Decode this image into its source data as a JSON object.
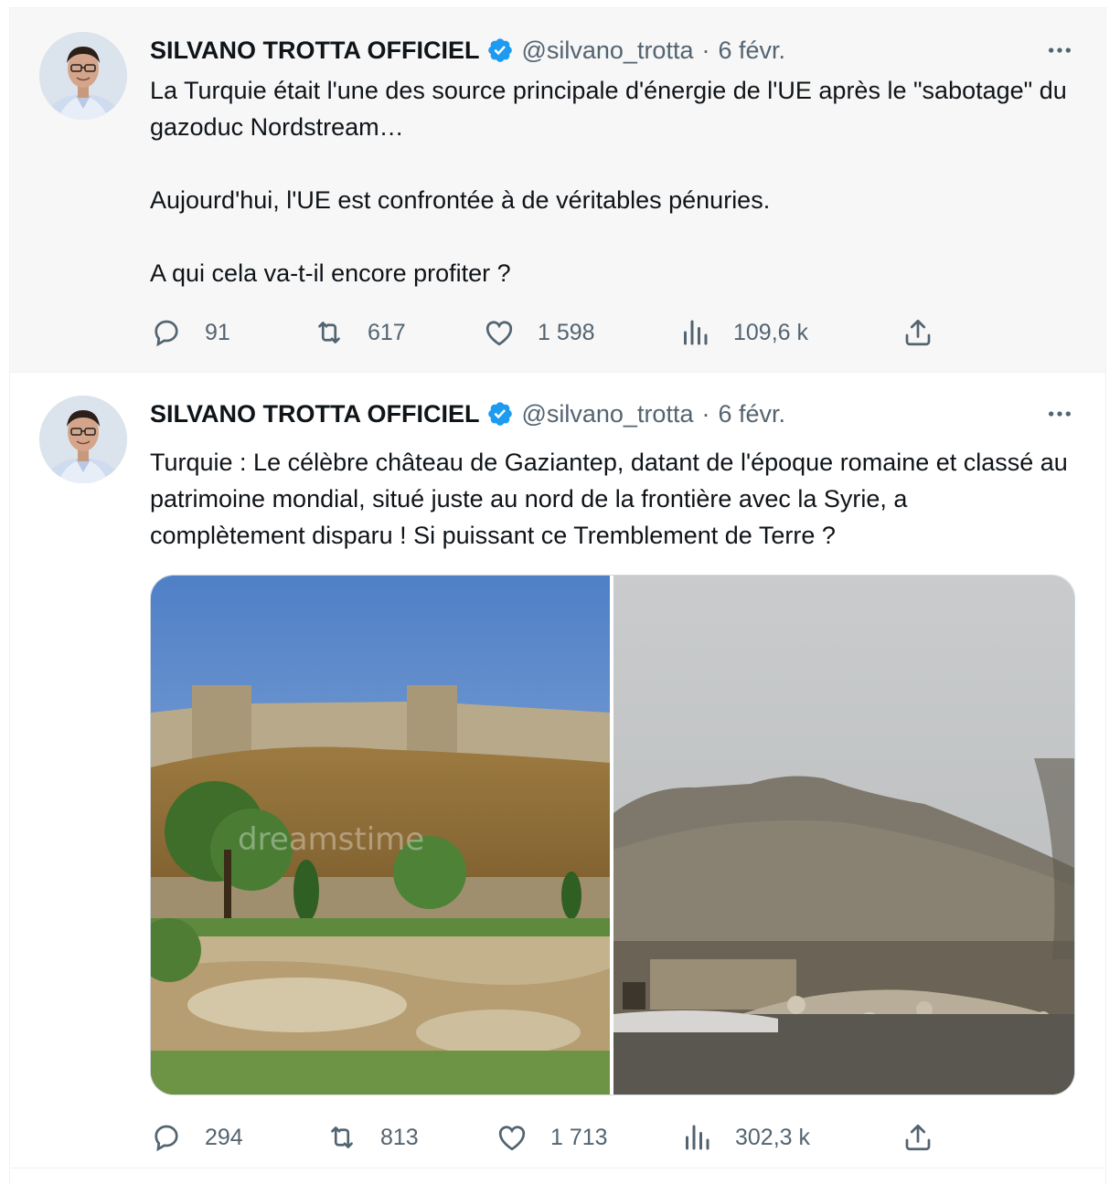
{
  "tweets": [
    {
      "author_name": "SILVANO TROTTA OFFICIEL",
      "handle": "@silvano_trotta",
      "separator": "·",
      "date": "6 févr.",
      "paragraphs": [
        "La Turquie était l'une des source principale d'énergie de l'UE après le \"sabotage\" du gazoduc Nordstream…",
        "Aujourd'hui, l'UE est confrontée à de véritables pénuries.",
        "A qui cela va-t-il encore profiter ?"
      ],
      "replies": "91",
      "retweets": "617",
      "likes": "1 598",
      "views": "109,6 k"
    },
    {
      "author_name": "SILVANO TROTTA OFFICIEL",
      "handle": "@silvano_trotta",
      "separator": "·",
      "date": "6 févr.",
      "paragraphs": [
        "Turquie : Le célèbre château de Gaziantep, datant de l'époque romaine et classé au patrimoine mondial, situé juste au nord de la frontière avec la Syrie, a complètement disparu ! Si puissant ce Tremblement de Terre ?"
      ],
      "media": [
        {
          "description": "castle-before-photo",
          "watermark": "dreamstime"
        },
        {
          "description": "castle-after-earthquake-photo"
        }
      ],
      "replies": "294",
      "retweets": "813",
      "likes": "1 713",
      "views": "302,3 k"
    }
  ],
  "icons": {
    "verified": "verified-badge-icon",
    "more": "more-icon",
    "reply": "reply-icon",
    "retweet": "retweet-icon",
    "like": "like-icon",
    "views": "views-icon",
    "share": "share-icon"
  },
  "colors": {
    "verified": "#1d9bf0",
    "secondary_text": "#536471",
    "primary_text": "#0f1419"
  }
}
